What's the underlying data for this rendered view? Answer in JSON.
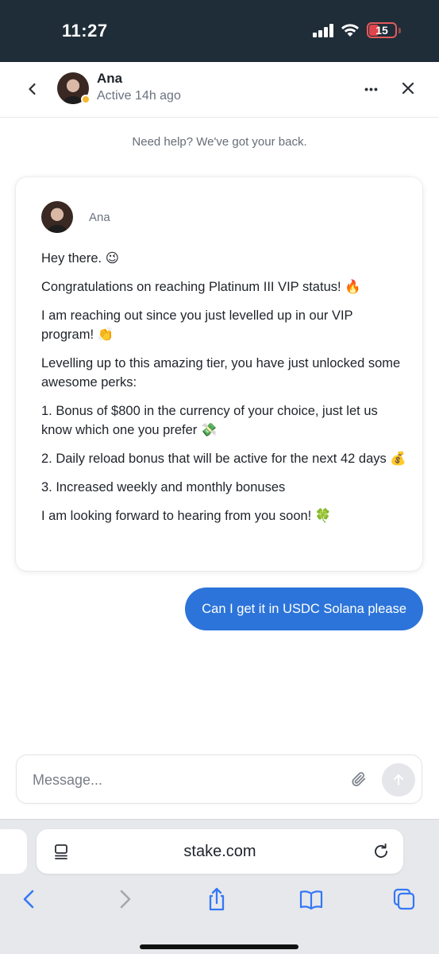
{
  "status_bar": {
    "time": "11:27",
    "battery_level": "15",
    "battery_color": "#e0454b",
    "icons": [
      "signal-icon",
      "wifi-icon",
      "battery-icon"
    ]
  },
  "header": {
    "contact_name": "Ana",
    "status": "Active 14h ago",
    "status_dot_color": "#f5b82e",
    "icons": [
      "chevron-left-icon",
      "more-icon",
      "close-icon"
    ]
  },
  "chat": {
    "help_text": "Need help? We've got your back.",
    "agent_message": {
      "sender": "Ana",
      "paragraphs": [
        {
          "text": "Hey there.",
          "emoji": "😉"
        },
        {
          "text": "Congratulations on reaching Platinum III VIP status!",
          "emoji": "🔥"
        },
        {
          "text": "I am reaching out since you just levelled up in our VIP program!",
          "emoji": "👏"
        },
        {
          "text": "Levelling up to this amazing tier, you have just unlocked some awesome perks:",
          "emoji": ""
        },
        {
          "text": "1. Bonus of $800 in the currency of your choice, just let us know which one you prefer",
          "emoji": "💸"
        },
        {
          "text": "2. Daily reload bonus that will be active for the next 42 days",
          "emoji": "💰"
        },
        {
          "text": "3. Increased weekly and monthly bonuses",
          "emoji": ""
        },
        {
          "text": "I am looking forward to hearing from you soon!",
          "emoji": "🍀"
        }
      ]
    },
    "user_message": "Can I get it in USDC Solana please",
    "user_bubble_color": "#2c74d9"
  },
  "composer": {
    "placeholder": "Message...",
    "value": "",
    "icons": [
      "paperclip-icon",
      "send-arrow-icon"
    ]
  },
  "browser": {
    "url": "stake.com",
    "icons": [
      "reader-mode-icon",
      "reload-icon",
      "back-icon",
      "forward-icon",
      "share-icon",
      "bookmarks-icon",
      "tabs-icon"
    ],
    "accent": "#3478f6"
  }
}
